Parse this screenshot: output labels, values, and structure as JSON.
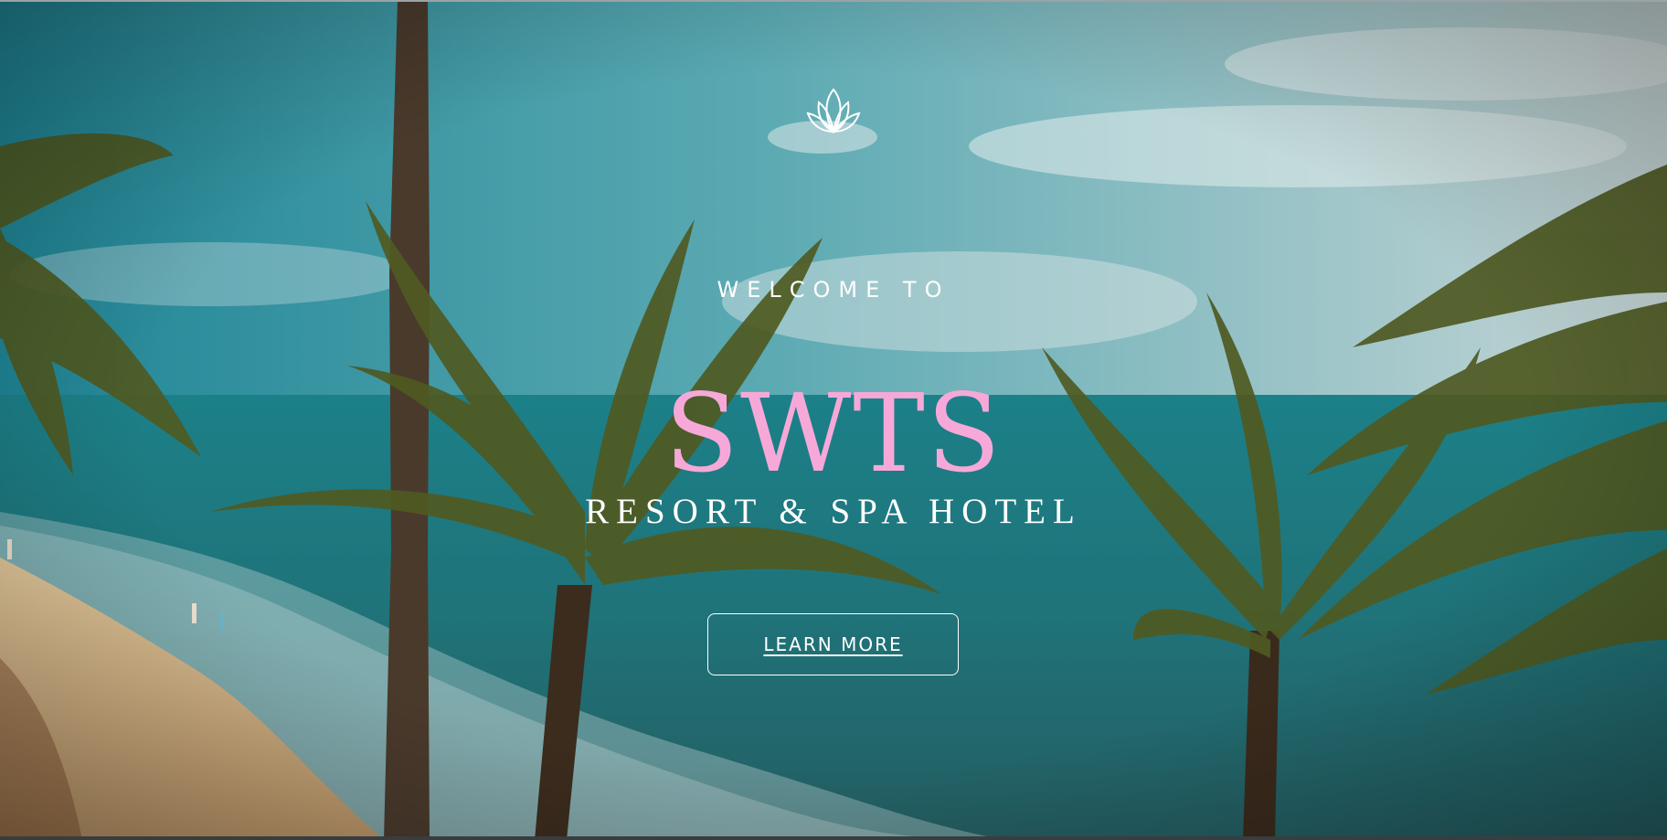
{
  "hero": {
    "welcome_text": "WELCOME TO",
    "brand_name": "SWTS",
    "subtitle": "RESORT & SPA HOTEL",
    "cta_label": "LEARN MORE",
    "logo_icon": "lotus-icon",
    "background": "beach-palm-trees-ocean-video"
  },
  "colors": {
    "brand_pink": "#f6a9d8",
    "text_white": "#ffffff",
    "ocean_teal": "#1d7b82",
    "sky_teal": "#2a8f9c",
    "sand": "#d9bf93"
  }
}
